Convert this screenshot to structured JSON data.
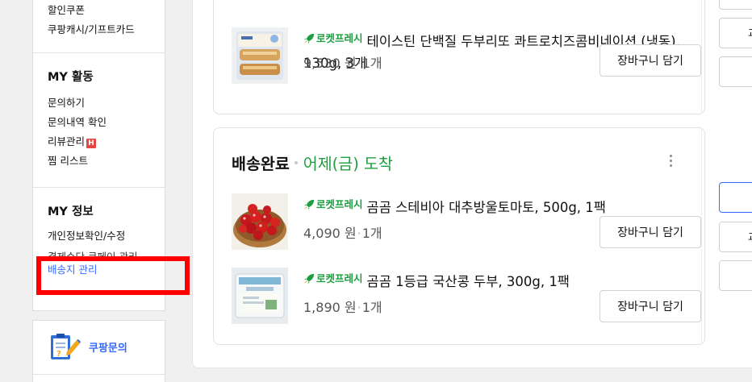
{
  "sidebar": {
    "top_links": [
      "할인쿠폰",
      "쿠팡캐시/기프트카드"
    ],
    "activity": {
      "title": "MY 활동",
      "items": [
        "문의하기",
        "문의내역 확인",
        "리뷰관리",
        "찜 리스트"
      ],
      "badge": "H"
    },
    "info": {
      "title": "MY 정보",
      "items": [
        "개인정보확인/수정",
        "결제수단·쿠페이 관리",
        "배송지 관리"
      ]
    },
    "inquiry": {
      "label": "쿠팡문의"
    }
  },
  "orders": [
    {
      "items": [
        {
          "badge": "로켓프레시",
          "name": "테이스틴 단백질 두부리또 콰트로치즈콤비네이션 (냉동), 130g, 3개",
          "price": "9,530 원",
          "qty": "1개",
          "cart_label": "장바구니 담기"
        }
      ]
    },
    {
      "status": "배송완료",
      "arrival": "어제(금) 도착",
      "items": [
        {
          "badge": "로켓프레시",
          "name": "곰곰 스테비아 대추방울토마토, 500g, 1팩",
          "price": "4,090 원",
          "qty": "1개",
          "cart_label": "장바구니 담기"
        },
        {
          "badge": "로켓프레시",
          "name": "곰곰 1등급 국산콩 두부, 300g, 1팩",
          "price": "1,890 원",
          "qty": "1개",
          "cart_label": "장바구니 담기"
        }
      ]
    }
  ],
  "right_buttons": [
    "",
    "교",
    "",
    "",
    "교",
    ""
  ],
  "colors": {
    "accent_blue": "#346aff",
    "rocket_green": "#1d9e40",
    "arrival_green": "#1f9e3f",
    "highlight_red": "#ff0000"
  },
  "icons": [
    "rocket-icon",
    "clipboard-pencil-icon",
    "kebab-menu-icon",
    "hot-badge-icon"
  ]
}
